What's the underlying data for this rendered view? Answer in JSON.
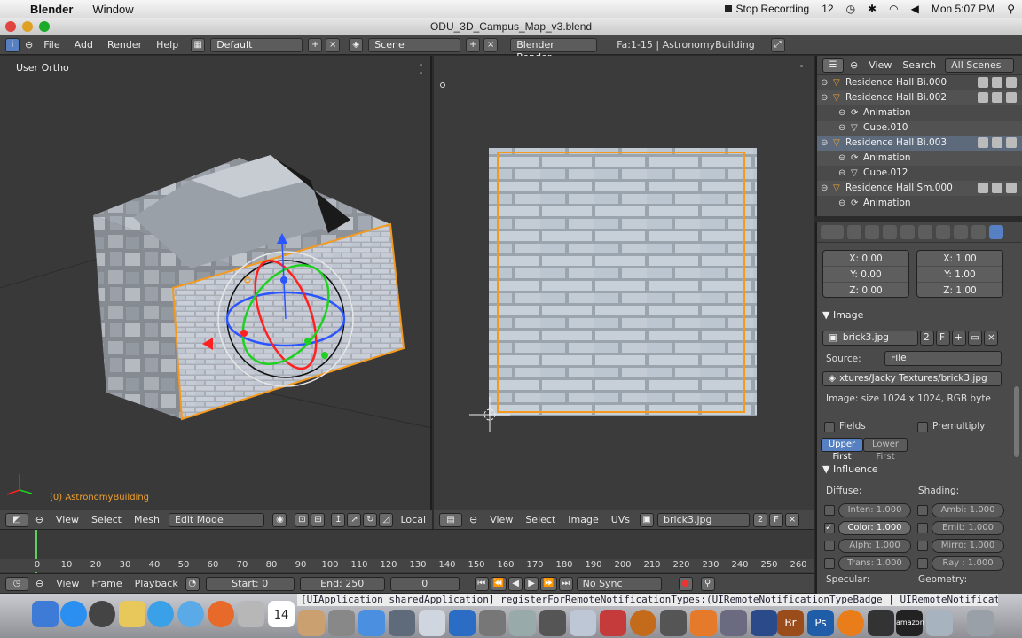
{
  "mac": {
    "app": "Blender",
    "menus": [
      "Window"
    ],
    "recording": "Stop Recording",
    "num": "12",
    "clock": "Mon 5:07 PM"
  },
  "window": {
    "title": "ODU_3D_Campus_Map_v3.blend"
  },
  "info": {
    "menus": [
      "File",
      "Add",
      "Render",
      "Help"
    ],
    "layout": "Default",
    "scene": "Scene",
    "engine": "Blender Render",
    "stats": "Fa:1-15 | AstronomyBuilding"
  },
  "view3d": {
    "label": "User Ortho",
    "object": "(0) AstronomyBuilding",
    "menus": [
      "View",
      "Select",
      "Mesh"
    ],
    "mode": "Edit Mode",
    "orientation": "Local"
  },
  "uv": {
    "menus": [
      "View",
      "Select",
      "Image",
      "UVs"
    ],
    "image": "brick3.jpg",
    "users": "2",
    "fake": "F"
  },
  "timeline": {
    "menus": [
      "View",
      "Frame",
      "Playback"
    ],
    "start": "Start: 0",
    "end": "End: 250",
    "current": "0",
    "sync": "No Sync",
    "ticks": [
      "0",
      "10",
      "20",
      "30",
      "40",
      "50",
      "60",
      "70",
      "80",
      "90",
      "100",
      "110",
      "120",
      "130",
      "140",
      "150",
      "160",
      "170",
      "180",
      "190",
      "200",
      "210",
      "220",
      "230",
      "240",
      "250",
      "260"
    ]
  },
  "outliner": {
    "menus": [
      "View",
      "Search"
    ],
    "filter": "All Scenes",
    "rows": [
      {
        "label": "Residence Hall Bi.000",
        "indent": 1,
        "type": "object"
      },
      {
        "label": "Residence Hall Bi.002",
        "indent": 1,
        "type": "object"
      },
      {
        "label": "Animation",
        "indent": 2,
        "type": "anim"
      },
      {
        "label": "Cube.010",
        "indent": 2,
        "type": "mesh"
      },
      {
        "label": "Residence Hall Bi.003",
        "indent": 1,
        "type": "object"
      },
      {
        "label": "Animation",
        "indent": 2,
        "type": "anim"
      },
      {
        "label": "Cube.012",
        "indent": 2,
        "type": "mesh"
      },
      {
        "label": "Residence Hall Sm.000",
        "indent": 1,
        "type": "object"
      },
      {
        "label": "Animation",
        "indent": 2,
        "type": "anim"
      }
    ]
  },
  "props": {
    "offset": [
      "X: 0.00",
      "Y: 0.00",
      "Z: 0.00"
    ],
    "size": [
      "X: 1.00",
      "Y: 1.00",
      "Z: 1.00"
    ],
    "image_section": "Image",
    "image_name": "brick3.jpg",
    "image_users": "2",
    "image_fake": "F",
    "source_label": "Source:",
    "source_value": "File",
    "filepath": "xtures/Jacky Textures/brick3.jpg",
    "image_info": "Image: size 1024 x 1024, RGB byte",
    "fields": "Fields",
    "premultiply": "Premultiply",
    "upper_first": "Upper First",
    "lower_first": "Lower First",
    "influence": "Influence",
    "diffuse": "Diffuse:",
    "shading": "Shading:",
    "inf_left": [
      "Inten: 1.000",
      "Color: 1.000",
      "Alph: 1.000",
      "Trans: 1.000"
    ],
    "inf_right": [
      "Ambi: 1.000",
      "Emit: 1.000",
      "Mirro: 1.000",
      "Ray : 1.000"
    ],
    "specular": "Specular:",
    "geometry": "Geometry:"
  },
  "dock": {
    "terminal": "[UIApplication sharedApplication] registerForRemoteNotificationTypes:(UIRemoteNotificationTypeBadge | UIRemoteNotification",
    "calendar": "14",
    "amazon": "amazon"
  }
}
